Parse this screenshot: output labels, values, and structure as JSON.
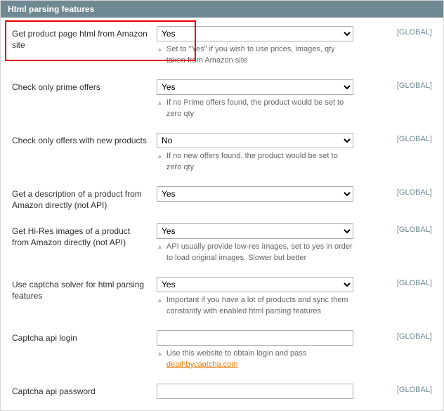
{
  "panel": {
    "title": "Html parsing features"
  },
  "scope_label": "[GLOBAL]",
  "options": {
    "yes": "Yes",
    "no": "No"
  },
  "fields": {
    "get_html": {
      "label": "Get product page html from Amazon site",
      "value": "Yes",
      "help": "Set to \"Yes\" if you wish to use prices, images, qty taken from Amazon site"
    },
    "prime": {
      "label": "Check only prime offers",
      "value": "Yes",
      "help": "If no Prime offers found, the product would be set to zero qty"
    },
    "new_products": {
      "label": "Check only offers with new products",
      "value": "No",
      "help": "If no new offers found, the product would be set to zero qty"
    },
    "description": {
      "label": "Get a description of a product from Amazon directly (not API)",
      "value": "Yes",
      "help": ""
    },
    "hires": {
      "label": "Get Hi-Res images of a product from Amazon directly (not API)",
      "value": "Yes",
      "help": "API usually provide low-res images, set to yes in order to load original images. Slower but better"
    },
    "captcha_solver": {
      "label": "Use captcha solver for html parsing features",
      "value": "Yes",
      "help": "Important if you have a lot of products and sync them constantly with enabled html parsing features"
    },
    "captcha_login": {
      "label": "Captcha api login",
      "value": "",
      "help_prefix": "Use this website to obtain login and pass ",
      "help_link": "deathbycaptcha.com"
    },
    "captcha_pass": {
      "label": "Captcha api password",
      "value": ""
    }
  }
}
